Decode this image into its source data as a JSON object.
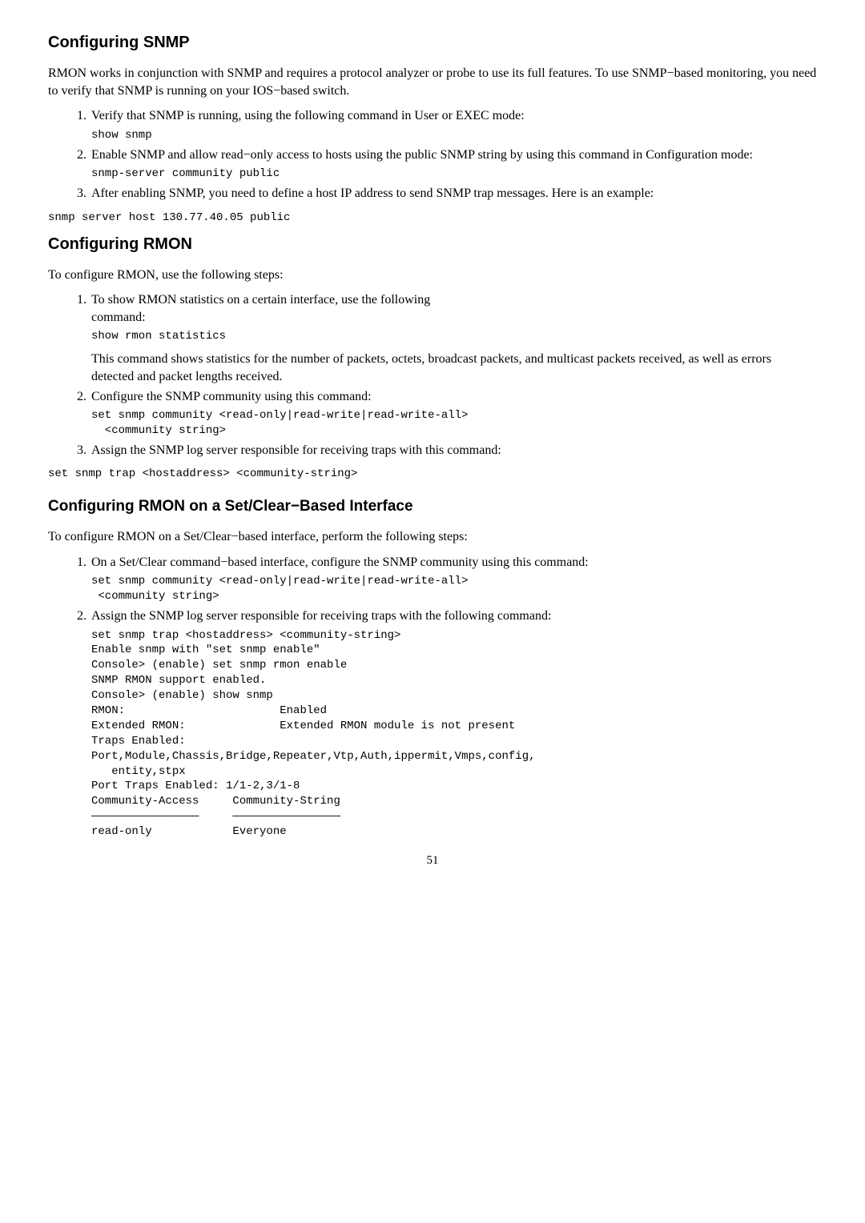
{
  "s1": {
    "title": "Configuring SNMP",
    "p1": "RMON works in conjunction with SNMP and requires a protocol analyzer or probe to use its full features. To use SNMP−based monitoring, you need to verify that SNMP is running on your IOS−based switch.",
    "li1": "Verify that SNMP is running, using the following command in User or EXEC mode:",
    "code1": "show snmp",
    "li2": "Enable SNMP and allow read−only access to hosts using the public SNMP string by using this command in Configuration mode:",
    "code2": "snmp-server community public",
    "li3": "After enabling SNMP, you need to define a host IP address to send SNMP trap messages. Here is an example:",
    "code3": "snmp server host 130.77.40.05 public"
  },
  "s2": {
    "title": "Configuring RMON",
    "p1": "To configure RMON, use the following steps:",
    "li1a": "To show RMON statistics on a certain interface, use the following",
    "li1b": "command:",
    "code1": "show rmon statistics",
    "li1c": "This command shows statistics for the number of packets, octets, broadcast packets, and multicast packets received, as well as errors detected and packet lengths received.",
    "li2": "Configure the SNMP community using this command:",
    "code2": "set snmp community <read-only|read-write|read-write-all>\n  <community string>",
    "li3": "Assign the SNMP log server responsible for receiving traps with this command:",
    "code3": "set snmp trap <hostaddress> <community-string>"
  },
  "s3": {
    "title": "Configuring RMON on a Set/Clear−Based Interface",
    "p1": "To configure RMON on a Set/Clear−based interface, perform the following steps:",
    "li1": "On a Set/Clear command−based interface, configure the SNMP community using this command:",
    "code1": "set snmp community <read-only|read-write|read-write-all>\n <community string>",
    "li2": "Assign the SNMP log server responsible for receiving traps with the following command:",
    "code2": "set snmp trap <hostaddress> <community-string>\nEnable snmp with \"set snmp enable\"\nConsole> (enable) set snmp rmon enable\nSNMP RMON support enabled.\nConsole> (enable) show snmp\nRMON:                       Enabled\nExtended RMON:              Extended RMON module is not present\nTraps Enabled:\nPort,Module,Chassis,Bridge,Repeater,Vtp,Auth,ippermit,Vmps,config,\n   entity,stpx\nPort Traps Enabled: 1/1-2,3/1-8\nCommunity-Access     Community-String\n————————————————     ————————————————\nread-only            Everyone"
  },
  "page": "51"
}
